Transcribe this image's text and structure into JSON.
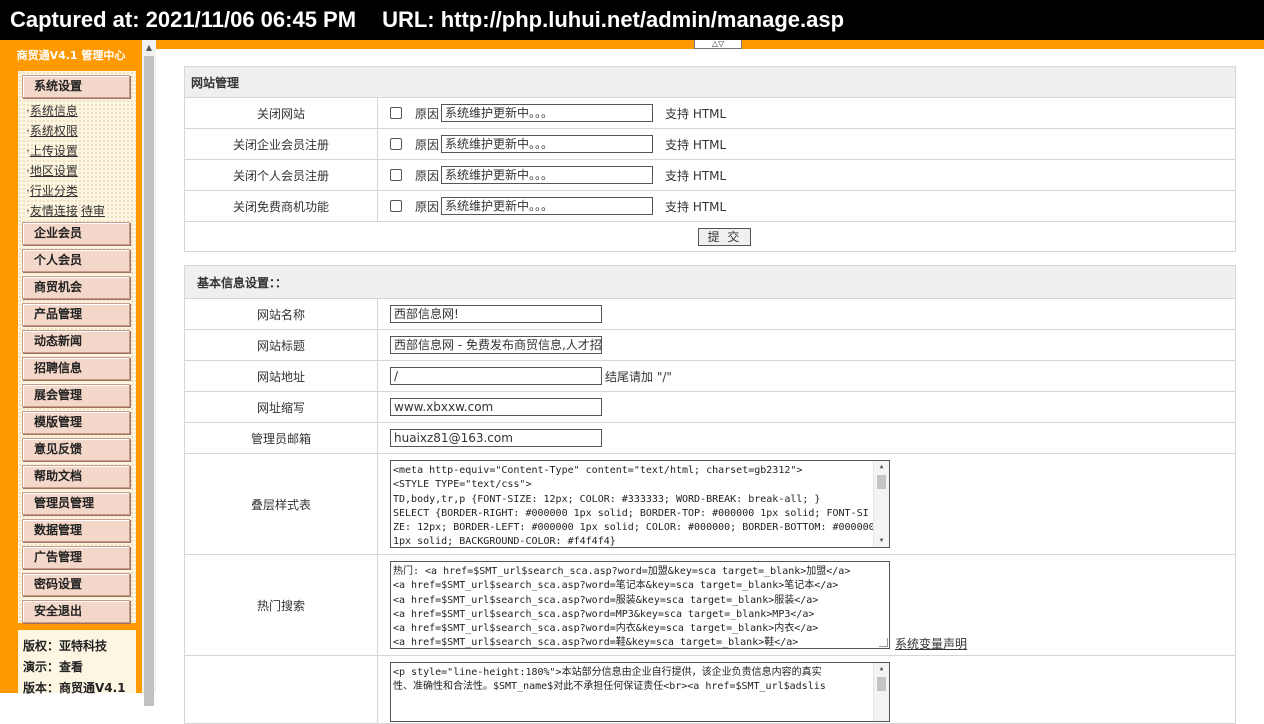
{
  "capture": {
    "time_text": "Captured at: 2021/11/06 06:45 PM",
    "url_text": "URL: http://php.luhui.net/admin/manage.asp"
  },
  "toggle_icon": "chevron-up-down-icon",
  "sidebar": {
    "title": "商贸通V4.1 管理中心",
    "section_system": "系统设置",
    "system_links": [
      "系统信息",
      "系统权限",
      "上传设置",
      "地区设置",
      "行业分类",
      "友情连接"
    ],
    "system_link_extra": "待审",
    "menu_items": [
      "企业会员",
      "个人会员",
      "商贸机会",
      "产品管理",
      "动态新闻",
      "招聘信息",
      "展会管理",
      "模版管理",
      "意见反馈",
      "帮助文档",
      "管理员管理",
      "数据管理",
      "广告管理",
      "密码设置",
      "安全退出"
    ],
    "info": [
      "版权：亚特科技",
      "演示：查看",
      "版本：商贸通V4.1"
    ]
  },
  "site_manage": {
    "header": "网站管理",
    "rows": [
      {
        "label": "关闭网站",
        "reason_label": "原因",
        "reason_value": "系统维护更新中。。。",
        "note": "支持 HTML",
        "checked": false
      },
      {
        "label": "关闭企业会员注册",
        "reason_label": "原因",
        "reason_value": "系统维护更新中。。。",
        "note": "支持 HTML",
        "checked": false
      },
      {
        "label": "关闭个人会员注册",
        "reason_label": "原因",
        "reason_value": "系统维护更新中。。。",
        "note": "支持 HTML",
        "checked": false
      },
      {
        "label": "关闭免费商机功能",
        "reason_label": "原因",
        "reason_value": "系统维护更新中。。。",
        "note": "支持 HTML",
        "checked": false
      }
    ],
    "submit_label": "提 交"
  },
  "basic_info": {
    "header": "基本信息设置：：",
    "site_name_label": "网站名称",
    "site_name_value": "西部信息网!",
    "site_title_label": "网站标题",
    "site_title_value": "西部信息网 - 免费发布商贸信息,人才招聘",
    "site_url_label": "网站地址",
    "site_url_value": "/",
    "site_url_note": "结尾请加 \"/\"",
    "site_abbr_label": "网址缩写",
    "site_abbr_value": "www.xbxxw.com",
    "admin_email_label": "管理员邮箱",
    "admin_email_value": "huaixz81@163.com",
    "css_label": "叠层样式表",
    "css_lines": [
      "<meta http-equiv=\"Content-Type\" content=\"text/html; charset=gb2312\">",
      "<STYLE TYPE=\"text/css\">",
      "TD,body,tr,p    {FONT-SIZE: 12px; COLOR: #333333; WORD-BREAK: break-all; }",
      "SELECT  {BORDER-RIGHT: #000000 1px solid; BORDER-TOP: #000000 1px solid; FONT-SI",
      "ZE: 12px; BORDER-LEFT: #000000 1px solid; COLOR: #000000; BORDER-BOTTOM: #000000",
      "1px solid; BACKGROUND-COLOR: #f4f4f4}"
    ],
    "hot_label": "热门搜索",
    "hot_lines": [
      "热门: <a href=$SMT_url$search_sca.asp?word=加盟&key=sca target=_blank>加盟</a>",
      "<a href=$SMT_url$search_sca.asp?word=笔记本&key=sca target=_blank>笔记本</a>",
      "<a href=$SMT_url$search_sca.asp?word=服装&key=sca target=_blank>服装</a>",
      "<a href=$SMT_url$search_sca.asp?word=MP3&key=sca target=_blank>MP3</a>",
      "<a href=$SMT_url$search_sca.asp?word=内衣&key=sca target=_blank>内衣</a>",
      "<a href=$SMT_url$search_sca.asp?word=鞋&key=sca target=_blank>鞋</a>"
    ],
    "hot_var_link": "系统变量声明",
    "footer_lines": [
      "<p style=\"line-height:180%\">本站部分信息由企业自行提供，该企业负责信息内容的真实",
      "性、准确性和合法性。$SMT_name$对此不承担任何保证责任<br><a href=$SMT_url$adslis"
    ]
  }
}
